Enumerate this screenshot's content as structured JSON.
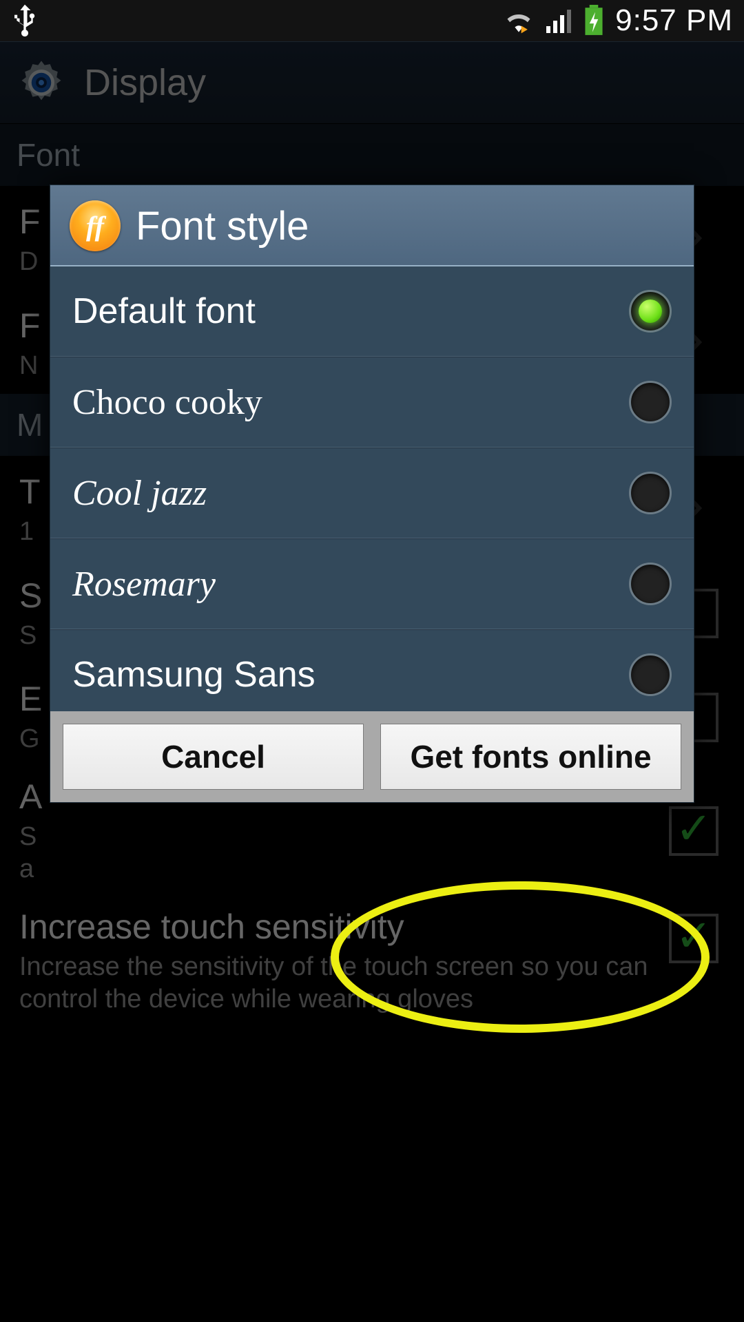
{
  "status_bar": {
    "time": "9:57 PM"
  },
  "header": {
    "title": "Display"
  },
  "settings": {
    "section_font_label": "Font",
    "items": [
      {
        "title": "F",
        "sub": "D"
      },
      {
        "title": "F",
        "sub": "N"
      }
    ],
    "section_more_label": "M",
    "more_item": {
      "title": "T",
      "sub": "1"
    },
    "s_item": {
      "title": "S",
      "sub": "S"
    },
    "e_item": {
      "title": "E",
      "sub": "G"
    },
    "a_item": {
      "title": "A",
      "sub": "S",
      "sub2": "a"
    },
    "touch_item": {
      "title": "Increase touch sensitivity",
      "sub": "Increase the sensitivity of the touch screen so you can control the device while wearing gloves"
    }
  },
  "dialog": {
    "title": "Font style",
    "options": [
      {
        "label": "Default font",
        "selected": true,
        "font_class": ""
      },
      {
        "label": "Choco cooky",
        "selected": false,
        "font_class": "font-choco"
      },
      {
        "label": "Cool jazz",
        "selected": false,
        "font_class": "font-cooljazz"
      },
      {
        "label": "Rosemary",
        "selected": false,
        "font_class": "font-rosemary"
      },
      {
        "label": "Samsung Sans",
        "selected": false,
        "font_class": "font-samsung"
      }
    ],
    "cancel_label": "Cancel",
    "get_online_label": "Get fonts online"
  }
}
